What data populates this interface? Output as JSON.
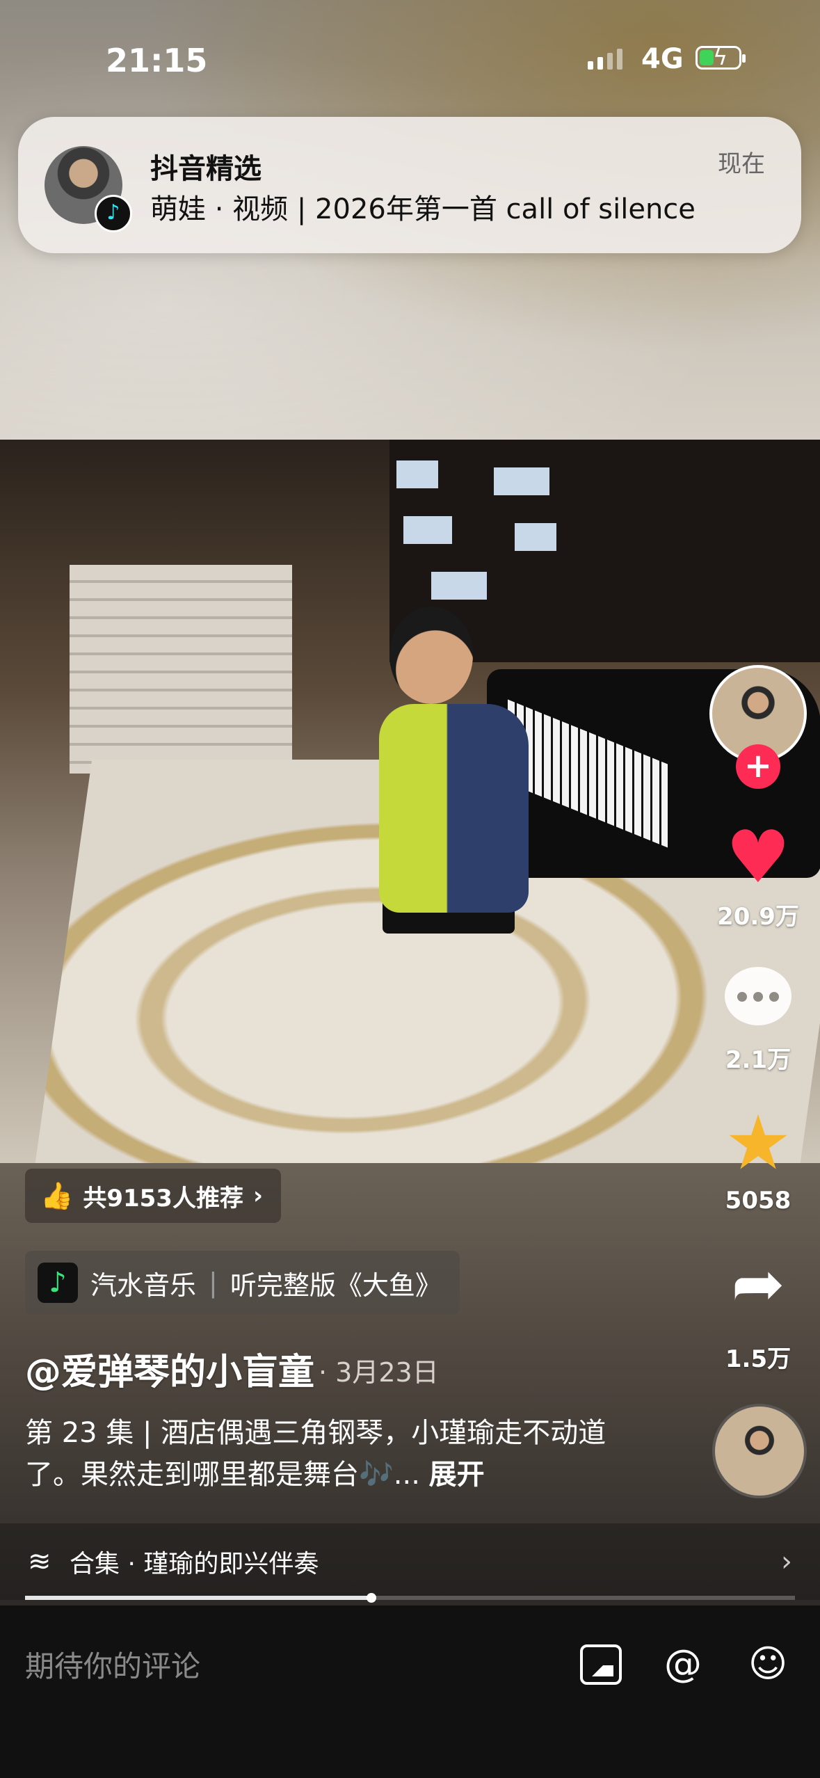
{
  "status_bar": {
    "time": "21:15",
    "network": "4G"
  },
  "notification": {
    "app": "抖音精选",
    "body": "萌娃 · 视频 | 2026年第一首 call of silence",
    "time": "现在"
  },
  "right_rail": {
    "likes": "20.9万",
    "comments": "2.1万",
    "favorites": "5058",
    "shares": "1.5万"
  },
  "overlay": {
    "recommend": "共9153人推荐",
    "music_app": "汽水音乐",
    "music_text": "听完整版《大鱼》",
    "handle": "@爱弹琴的小盲童",
    "date": "· 3月23日",
    "description": "第 23 集 | 酒店偶遇三角钢琴，小瑾瑜走不动道了。果然走到哪里都是舞台🎶...",
    "expand": "展开",
    "collection": "合集 · 瑾瑜的即兴伴奏",
    "progress": 0.45
  },
  "comment_bar": {
    "placeholder": "期待你的评论"
  },
  "colors": {
    "accent": "#fe2c55",
    "star": "#f7b52c"
  }
}
